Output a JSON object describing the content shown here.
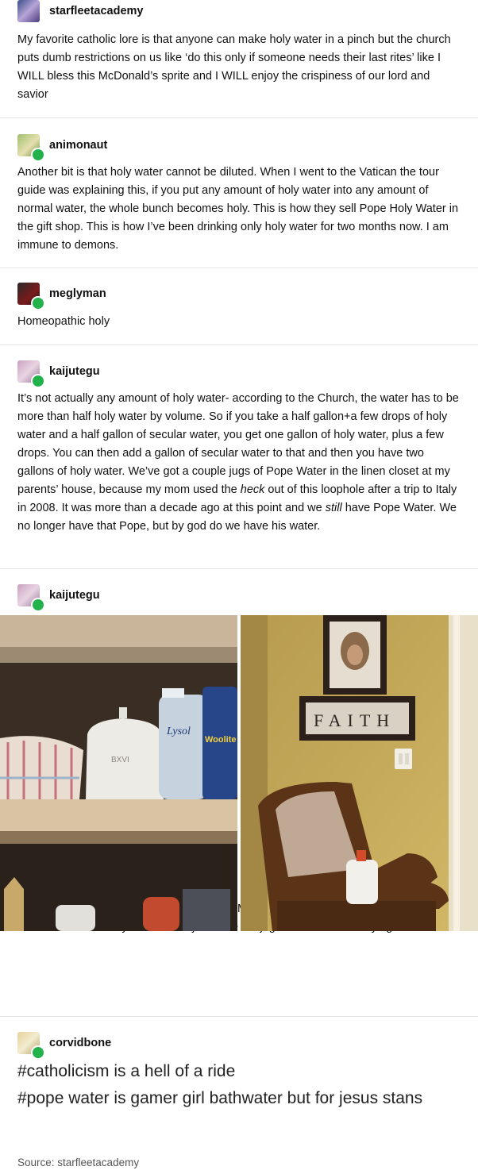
{
  "posts": [
    {
      "username": "starfleetacademy",
      "avatar_icon": "starfleet-avatar-icon",
      "text": "My favorite catholic lore is that anyone can make holy water in a pinch but the church puts dumb restrictions on us like ‘do this only if someone needs their last rites’ like I WILL bless this McDonald’s sprite and I WILL enjoy the crispiness of our lord and savior"
    },
    {
      "username": "animonaut",
      "avatar_icon": "animonaut-avatar-icon",
      "text": "Another bit is that holy water cannot be diluted. When I went to the Vatican the tour guide was explaining this, if you put any amount of holy water into any amount of normal water, the whole bunch becomes holy. This is how they sell Pope Holy Water in the gift shop. This is how I’ve been drinking only holy water for two months now. I am immune to demons."
    },
    {
      "username": "meglyman",
      "avatar_icon": "meglyman-avatar-icon",
      "text": "Homeopathic holy"
    },
    {
      "username": "kaijutegu",
      "avatar_icon": "kaijutegu-avatar-icon",
      "text_parts": [
        "It’s not actually any amount of holy water- according to the Church, the water has to be more than half holy water by volume. So if you take a half gallon+a few drops of holy water and a half gallon of secular water, you get one gallon of holy water, plus a few drops. You can then add a gallon of secular water to that and then you have two gallons of holy water. We’ve got a couple jugs of Pope Water in the linen closet at my parents’ house, because my mom used the ",
        "heck",
        " out of this loophole after a trip to Italy in 2008. It was more than a decade ago at this point and we ",
        "still",
        " have Pope Water. We no longer have that Pope, but by god do we have his water."
      ]
    },
    {
      "username": "kaijutegu",
      "avatar_icon": "kaijutegu-avatar-icon",
      "text": "Here’s what a jug of Pope water looks like. Mom measured a fill line on them so that we never accidentally run out and just have old jugs of secular water lying around.",
      "photos": {
        "left": {
          "name": "linen-closet-photo",
          "jug_label": "BXVI",
          "spray_label": "Lysol",
          "detergent_label": "Woolite OX"
        },
        "right": {
          "name": "hallway-chair-photo",
          "frame_letters": "FAITH"
        }
      }
    },
    {
      "username": "corvidbone",
      "avatar_icon": "corvidbone-avatar-icon",
      "tags": [
        "#catholicism is a hell of a ride",
        "#pope water is gamer girl bathwater but for jesus stans"
      ]
    }
  ],
  "footer": {
    "source": "Source: starfleetacademy"
  },
  "colors": {
    "badge_green": "#22b24c",
    "divider": "#e3e3e3",
    "text": "#111111"
  }
}
